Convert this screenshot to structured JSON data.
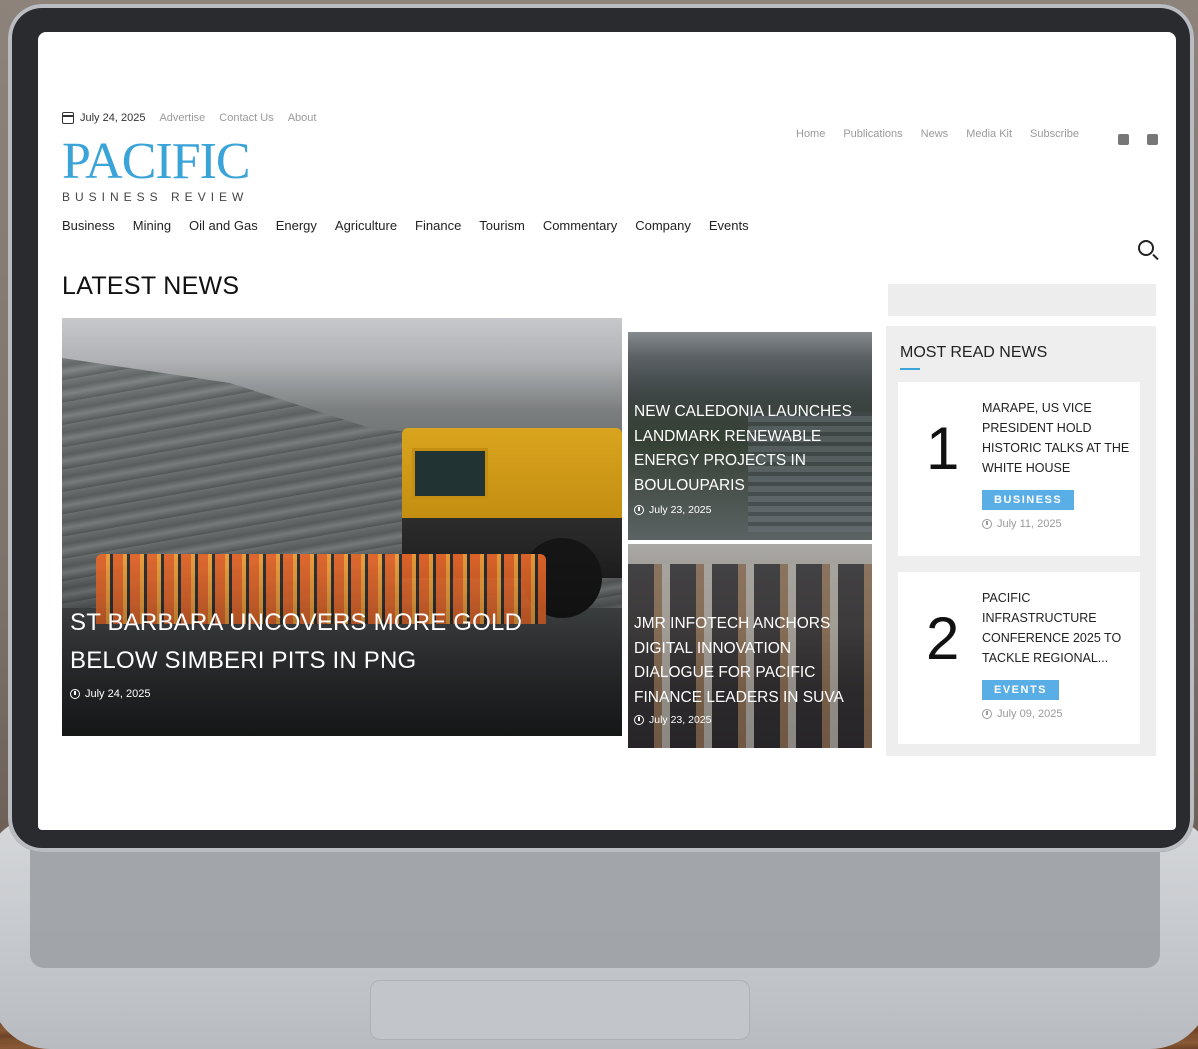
{
  "topbar": {
    "date": "July 24, 2025",
    "links": [
      "Advertise",
      "Contact Us",
      "About"
    ]
  },
  "logo": {
    "name": "PACIFIC",
    "tagline": "BUSINESS REVIEW"
  },
  "right_nav": [
    "Home",
    "Publications",
    "News",
    "Media Kit",
    "Subscribe"
  ],
  "social_icons": [
    "facebook-icon",
    "linkedin-icon"
  ],
  "categories": [
    "Business",
    "Mining",
    "Oil and Gas",
    "Energy",
    "Agriculture",
    "Finance",
    "Tourism",
    "Commentary",
    "Company",
    "Events"
  ],
  "section_title": "LATEST NEWS",
  "hero": {
    "title": "ST BARBARA UNCOVERS MORE GOLD BELOW SIMBERI PITS IN PNG",
    "date": "July 24, 2025"
  },
  "side_stories": [
    {
      "title": "NEW CALEDONIA LAUNCHES LANDMARK RENEWABLE ENERGY PROJECTS IN BOULOUPARIS",
      "date": "July 23, 2025"
    },
    {
      "title": "JMR INFOTECH ANCHORS DIGITAL INNOVATION DIALOGUE FOR PACIFIC FINANCE LEADERS IN SUVA",
      "date": "July 23, 2025"
    }
  ],
  "most_read": {
    "heading": "MOST READ NEWS",
    "items": [
      {
        "rank": "1",
        "title": "MARAPE, US VICE PRESIDENT HOLD HISTORIC TALKS AT THE WHITE HOUSE",
        "badge": "BUSINESS",
        "date": "July 11, 2025"
      },
      {
        "rank": "2",
        "title": "PACIFIC INFRASTRUCTURE CONFERENCE 2025 TO TACKLE REGIONAL...",
        "badge": "EVENTS",
        "date": "July 09, 2025"
      }
    ]
  },
  "colors": {
    "brand": "#3aa3d8",
    "badge": "#5aaee6"
  }
}
